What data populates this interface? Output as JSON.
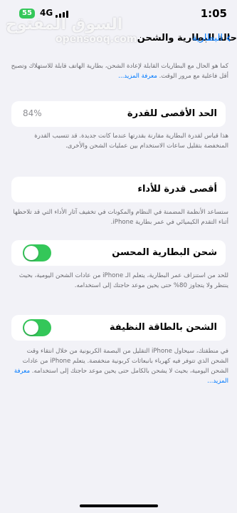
{
  "status_bar": {
    "battery_level": "55",
    "network": "4G",
    "time": "1:05"
  },
  "watermark": {
    "arabic": "السوق المفتوح",
    "latin": "opensooq.com"
  },
  "nav": {
    "back_label": "البطارية",
    "title": "حالة البطارية والشحن"
  },
  "intro": {
    "text": "كما هو الحال مع البطاريات القابلة لإعادة الشحن، بطارية الهاتف قابلة للاستهلاك وتصبح أقل فاعلية مع مرور الوقت.",
    "link": "معرفة المزيد..."
  },
  "max_capacity": {
    "label": "الحد الأقصى للقدرة",
    "value": "84%",
    "description": "هذا قياس لقدرة البطارية مقارنة بقدرتها عندما كانت جديدة. قد تتسبب القدرة المنخفضة بتقليل ساعات الاستخدام بين عمليات الشحن والأخرى."
  },
  "peak_performance": {
    "label": "أقصى قدرة للأداء",
    "description": "ستساعد الأنظمة المضمنة في النظام والمكونات في تخفيف آثار الأداء التي قد تلاحظها أثناء التقدم الكيميائي في عمر بطارية iPhone."
  },
  "optimized_charging": {
    "label": "شحن البطارية المحسن",
    "enabled": true,
    "description": "للحد من استنزاف عمر البطارية، يتعلم الـ iPhone من عادات الشحن اليومية، بحيث ينتظر ولا يتجاوز 80% حتى يحين موعد حاجتك إلى استخدامه."
  },
  "clean_energy": {
    "label": "الشحن بالطاقة النظيفة",
    "enabled": true,
    "description": "في منطقتك، سيحاول iPhone التقليل من البصمة الكربونية من خلال انتقاء وقت الشحن الذي تتوفر فيه كهرباء بانبعاثات كربونية منخفضة. يتعلم iPhone من عادات الشحن اليومية، بحيث لا يشحن بالكامل حتى يحين موعد حاجتك إلى استخدامه.",
    "link": "معرفة المزيد..."
  },
  "colors": {
    "accent": "#007aff",
    "toggle_on": "#34c759",
    "background": "#f2f2f7"
  }
}
